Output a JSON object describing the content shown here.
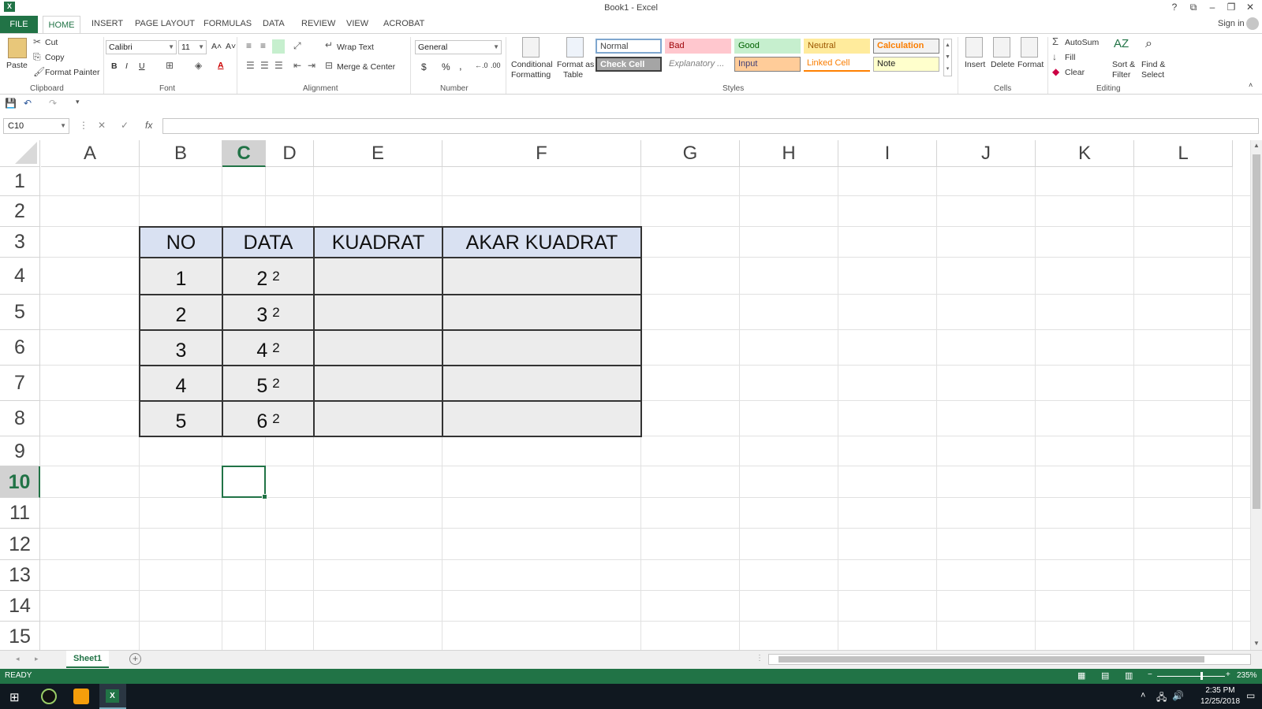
{
  "window": {
    "title": "Book1 - Excel",
    "help": "?",
    "restore_ribbon": "⧉",
    "minimize": "–",
    "maximize": "❐",
    "close": "✕",
    "logo_text": "X"
  },
  "tabs": {
    "file": "FILE",
    "home": "HOME",
    "insert": "INSERT",
    "page_layout": "PAGE LAYOUT",
    "formulas": "FORMULAS",
    "data": "DATA",
    "review": "REVIEW",
    "view": "VIEW",
    "acrobat": "ACROBAT",
    "sign_in": "Sign in"
  },
  "ribbon": {
    "clipboard": {
      "paste": "Paste",
      "cut": "Cut",
      "copy": "Copy",
      "format_painter": "Format Painter",
      "label": "Clipboard"
    },
    "font": {
      "name": "Calibri",
      "size": "11",
      "bold": "B",
      "italic": "I",
      "underline": "U",
      "label": "Font"
    },
    "alignment": {
      "wrap_text": "Wrap Text",
      "merge_center": "Merge & Center",
      "label": "Alignment"
    },
    "number": {
      "format": "General",
      "currency": "$",
      "percent": "%",
      "comma": ",",
      "label": "Number"
    },
    "styles": {
      "conditional": "Conditional",
      "conditional2": "Formatting",
      "format_table": "Format as",
      "format_table2": "Table",
      "normal": "Normal",
      "bad": "Bad",
      "good": "Good",
      "neutral": "Neutral",
      "calculation": "Calculation",
      "check_cell": "Check Cell",
      "explanatory": "Explanatory ...",
      "input": "Input",
      "linked_cell": "Linked Cell",
      "note": "Note",
      "label": "Styles"
    },
    "cells": {
      "insert": "Insert",
      "delete": "Delete",
      "format": "Format",
      "label": "Cells"
    },
    "editing": {
      "autosum": "AutoSum",
      "fill": "Fill",
      "clear": "Clear",
      "sort": "Sort &",
      "sort2": "Filter",
      "find": "Find &",
      "find2": "Select",
      "label": "Editing"
    }
  },
  "formula_bar": {
    "name_box": "C10",
    "value": ""
  },
  "columns": [
    "A",
    "B",
    "C",
    "D",
    "E",
    "F",
    "G",
    "H",
    "I",
    "J",
    "K",
    "L"
  ],
  "rows": [
    "1",
    "2",
    "3",
    "4",
    "5",
    "6",
    "7",
    "8",
    "9",
    "10",
    "11",
    "12",
    "13",
    "14",
    "15"
  ],
  "table": {
    "headers": [
      "NO",
      "DATA",
      "KUADRAT",
      "AKAR KUADRAT"
    ],
    "rows": [
      {
        "no": "1",
        "base": "2",
        "exp": "2"
      },
      {
        "no": "2",
        "base": "3",
        "exp": "2"
      },
      {
        "no": "3",
        "base": "4",
        "exp": "2"
      },
      {
        "no": "4",
        "base": "5",
        "exp": "2"
      },
      {
        "no": "5",
        "base": "6",
        "exp": "2"
      }
    ]
  },
  "sheet": {
    "name": "Sheet1",
    "add": "+"
  },
  "status": {
    "mode": "READY",
    "zoom": "235%"
  },
  "taskbar": {
    "time": "2:35 PM",
    "date": "12/25/2018"
  },
  "colors": {
    "excel_green": "#217346",
    "header_fill": "#d9e1f2",
    "body_fill": "#ececec"
  }
}
